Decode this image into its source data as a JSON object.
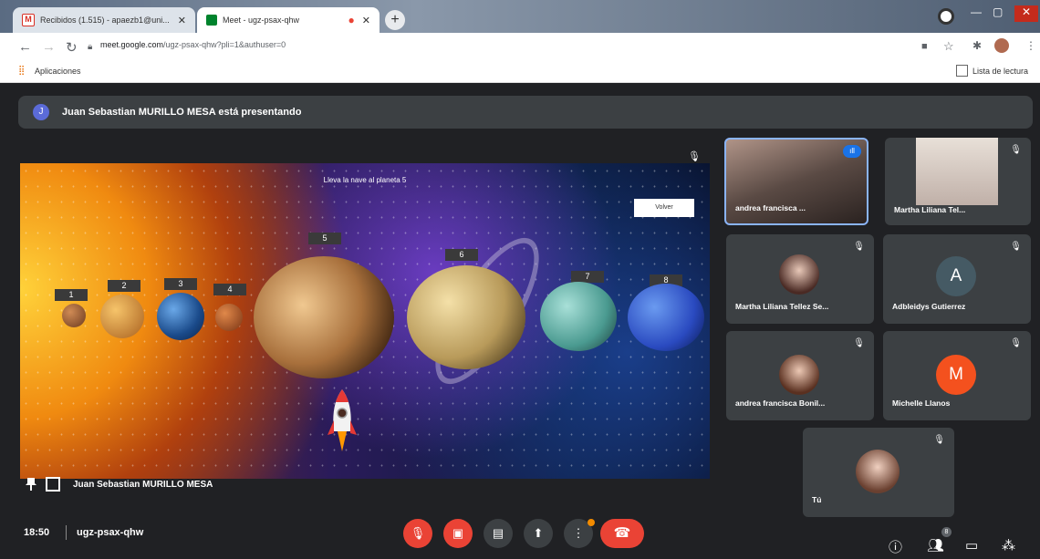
{
  "browser": {
    "tabs": [
      {
        "title": "Recibidos (1.515) - apaezb1@uni..."
      },
      {
        "title": "Meet - ugz-psax-qhw"
      }
    ],
    "url_host": "meet.google.com",
    "url_path": "/ugz-psax-qhw?pli=1&authuser=0",
    "apps_label": "Aplicaciones",
    "reading_list_label": "Lista de lectura"
  },
  "meet": {
    "presenting_banner": "Juan Sebastian MURILLO MESA está presentando",
    "presenter_initial": "J",
    "presenter_name": "Juan Sebastian MURILLO MESA",
    "slide": {
      "title": "Lleva la nave al planeta 5",
      "back_button": "Volver",
      "planet_numbers": [
        "1",
        "2",
        "3",
        "4",
        "5",
        "6",
        "7",
        "8"
      ]
    },
    "participants": [
      {
        "name": "andrea francisca ..."
      },
      {
        "name": "Martha Liliana Tel..."
      },
      {
        "name": "Martha Liliana Tellez Se..."
      },
      {
        "name": "Adbleidys Gutierrez",
        "initial": "A"
      },
      {
        "name": "andrea francisca Bonil..."
      },
      {
        "name": "Michelle Llanos",
        "initial": "M"
      },
      {
        "name": "Tú"
      }
    ],
    "time": "18:50",
    "meeting_code": "ugz-psax-qhw",
    "people_count": "8"
  },
  "colors": {
    "meet_bg": "#202124",
    "tile_bg": "#3c4043",
    "danger_red": "#ea4335",
    "avatar_a": "#455a64",
    "avatar_m": "#f4511e"
  },
  "icons": [
    "gmail-icon",
    "meet-icon",
    "close-icon",
    "plus-icon",
    "back-icon",
    "forward-icon",
    "reload-icon",
    "lock-icon",
    "star-icon",
    "extensions-icon",
    "profile-icon",
    "menu-icon",
    "apps-icon",
    "reading-list-icon",
    "mic-off-icon",
    "camera-off-icon",
    "captions-icon",
    "present-icon",
    "more-icon",
    "hangup-icon",
    "info-icon",
    "people-icon",
    "chat-icon",
    "activities-icon",
    "pin-icon"
  ]
}
